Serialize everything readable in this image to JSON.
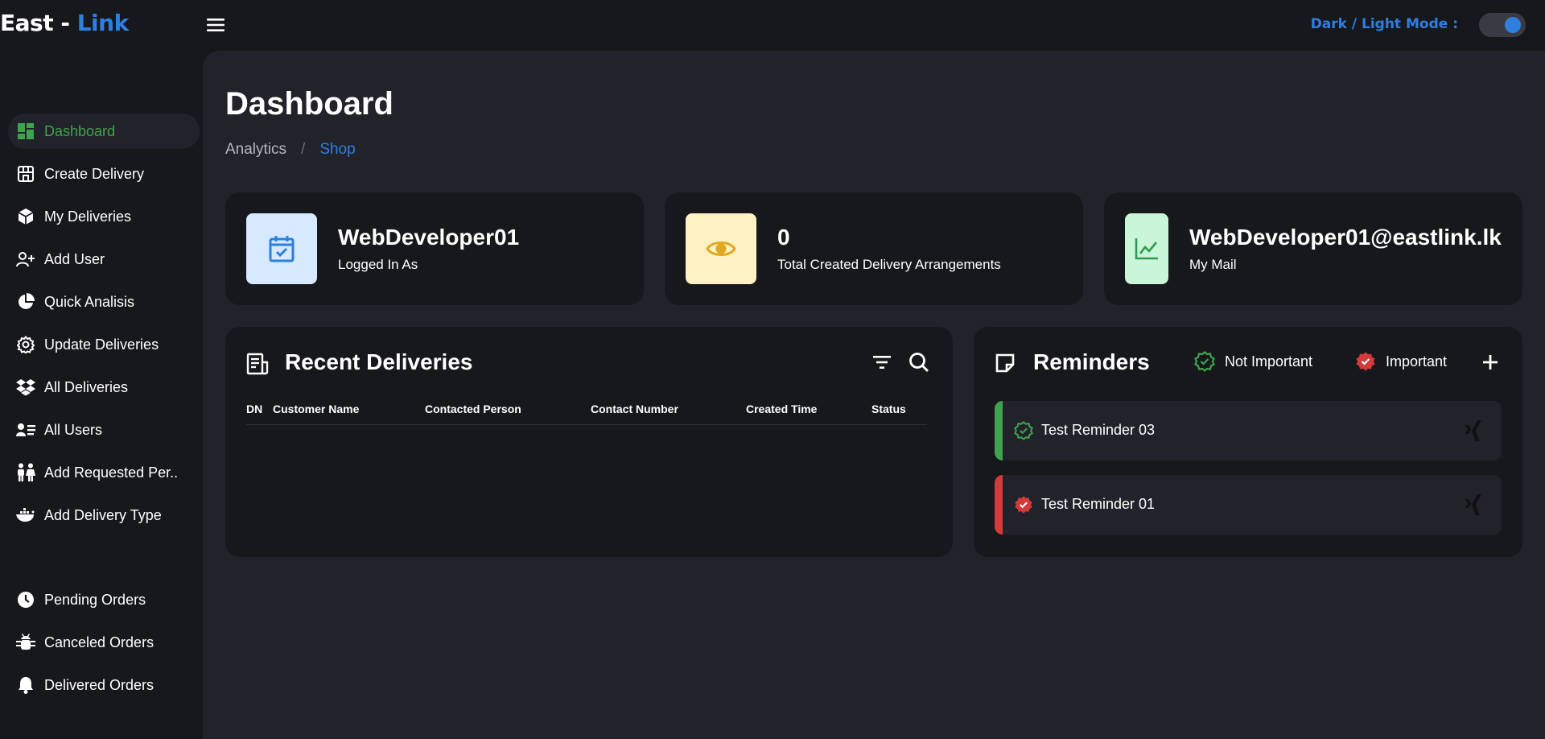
{
  "app": {
    "logo_main": "East -",
    "logo_accent": "Link"
  },
  "header": {
    "mode_label": "Dark / Light Mode :",
    "mode_toggle_on": true
  },
  "colors": {
    "accent": "#2f7fe0",
    "active_green": "#3fa34d",
    "important_red": "#d33a3a",
    "not_important_green": "#3fa34d"
  },
  "sidebar": {
    "items": [
      {
        "label": "Dashboard",
        "icon": "dashboard-icon",
        "active": true
      },
      {
        "label": "Create Delivery",
        "icon": "store-icon"
      },
      {
        "label": "My Deliveries",
        "icon": "package-icon"
      },
      {
        "label": "Add User",
        "icon": "user-plus-icon"
      },
      {
        "label": "Quick Analisis",
        "icon": "pie-chart-icon"
      },
      {
        "label": "Update Deliveries",
        "icon": "gear-icon"
      },
      {
        "label": "All Deliveries",
        "icon": "dropbox-icon"
      },
      {
        "label": "All Users",
        "icon": "user-list-icon"
      },
      {
        "label": "Add Requested Per..",
        "icon": "people-icon"
      },
      {
        "label": "Add Delivery Type",
        "icon": "ship-icon"
      }
    ],
    "bottom_items": [
      {
        "label": "Pending Orders",
        "icon": "clock-icon"
      },
      {
        "label": "Canceled Orders",
        "icon": "bug-icon"
      },
      {
        "label": "Delivered Orders",
        "icon": "bell-icon"
      }
    ]
  },
  "page": {
    "title": "Dashboard",
    "breadcrumb": {
      "first": "Analytics",
      "separator": "/",
      "current": "Shop"
    }
  },
  "stats": [
    {
      "value": "WebDeveloper01",
      "caption": "Logged In As",
      "icon": "calendar-check-icon",
      "badge_color": "#d6e9ff"
    },
    {
      "value": "0",
      "caption": "Total Created Delivery Arrangements",
      "icon": "eye-icon",
      "badge_color": "#fff1c4"
    },
    {
      "value": "WebDeveloper01@eastlink.lk",
      "caption": "My Mail",
      "icon": "trend-chart-icon",
      "badge_color": "#c9f6d9"
    }
  ],
  "recent": {
    "title": "Recent Deliveries",
    "columns": [
      "DN",
      "Customer Name",
      "Contacted Person",
      "Contact Number",
      "Created Time",
      "Status"
    ],
    "rows": []
  },
  "reminders": {
    "title": "Reminders",
    "legend_not_important": "Not Important",
    "legend_important": "Important",
    "items": [
      {
        "text": "Test Reminder 03",
        "important": false
      },
      {
        "text": "Test Reminder 01",
        "important": true
      }
    ]
  }
}
